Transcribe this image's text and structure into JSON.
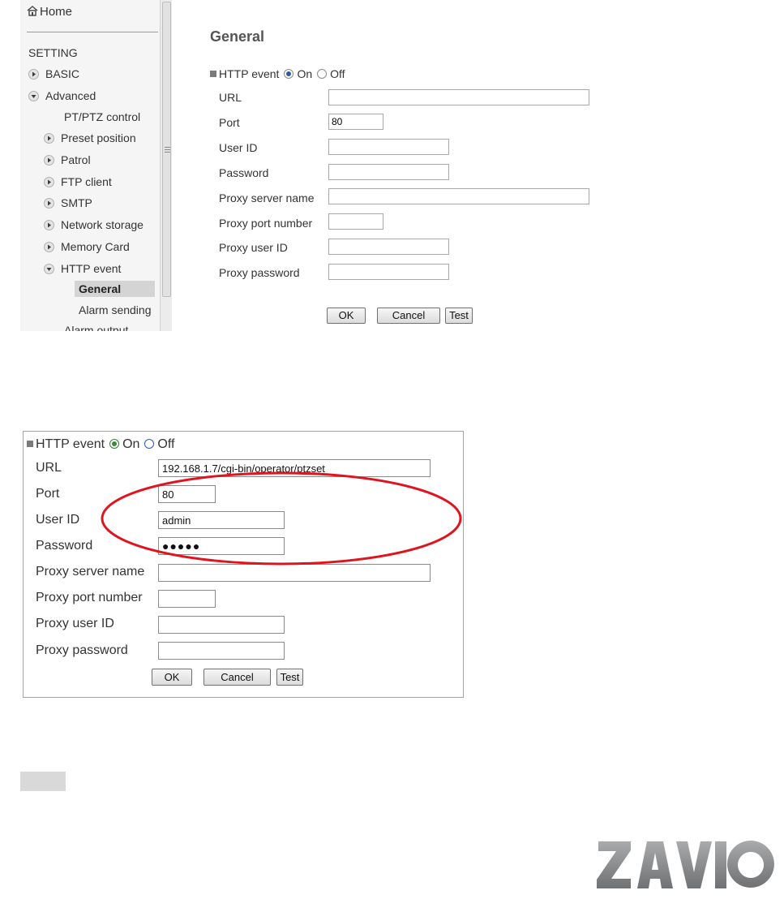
{
  "shot1": {
    "sidebar": {
      "home_label": "Home",
      "section_heading": "SETTING",
      "items": [
        {
          "label": "BASIC",
          "icon": "arrow-right-icon"
        },
        {
          "label": "Advanced",
          "icon": "arrow-down-icon"
        },
        {
          "label": "PT/PTZ control"
        },
        {
          "label": "Preset position",
          "icon": "arrow-right-icon"
        },
        {
          "label": "Patrol",
          "icon": "arrow-right-icon"
        },
        {
          "label": "FTP client",
          "icon": "arrow-right-icon"
        },
        {
          "label": "SMTP",
          "icon": "arrow-right-icon"
        },
        {
          "label": "Network storage",
          "icon": "arrow-right-icon"
        },
        {
          "label": "Memory Card",
          "icon": "arrow-right-icon"
        },
        {
          "label": "HTTP event",
          "icon": "arrow-down-icon"
        },
        {
          "label": "General",
          "active": true
        },
        {
          "label": "Alarm sending"
        },
        {
          "label": "Alarm output"
        }
      ]
    },
    "main": {
      "title": "General",
      "toggle": {
        "label": "HTTP event",
        "on_label": "On",
        "off_label": "Off",
        "selected": "On"
      },
      "fields": {
        "url": {
          "label": "URL",
          "value": ""
        },
        "port": {
          "label": "Port",
          "value": "80"
        },
        "user_id": {
          "label": "User ID",
          "value": ""
        },
        "password": {
          "label": "Password",
          "value": ""
        },
        "proxy_server": {
          "label": "Proxy server name",
          "value": ""
        },
        "proxy_port": {
          "label": "Proxy port number",
          "value": ""
        },
        "proxy_user": {
          "label": "Proxy user ID",
          "value": ""
        },
        "proxy_password": {
          "label": "Proxy password",
          "value": ""
        }
      },
      "buttons": {
        "ok": "OK",
        "cancel": "Cancel",
        "test": "Test"
      }
    }
  },
  "shot2": {
    "toggle": {
      "label": "HTTP event",
      "on_label": "On",
      "off_label": "Off",
      "selected": "On"
    },
    "fields": {
      "url": {
        "label": "URL",
        "value": "192.168.1.7/cgi-bin/operator/ptzset"
      },
      "port": {
        "label": "Port",
        "value": "80"
      },
      "user_id": {
        "label": "User ID",
        "value": "admin"
      },
      "password": {
        "label": "Password",
        "value": "●●●●●"
      },
      "proxy_server": {
        "label": "Proxy server name",
        "value": ""
      },
      "proxy_port": {
        "label": "Proxy port number",
        "value": ""
      },
      "proxy_user": {
        "label": "Proxy user ID",
        "value": ""
      },
      "proxy_password": {
        "label": "Proxy password",
        "value": ""
      }
    },
    "buttons": {
      "ok": "OK",
      "cancel": "Cancel",
      "test": "Test"
    },
    "highlight_color": "#e0141e"
  },
  "logo": {
    "text": "ZAVIO",
    "color": "#8a8c8e"
  }
}
